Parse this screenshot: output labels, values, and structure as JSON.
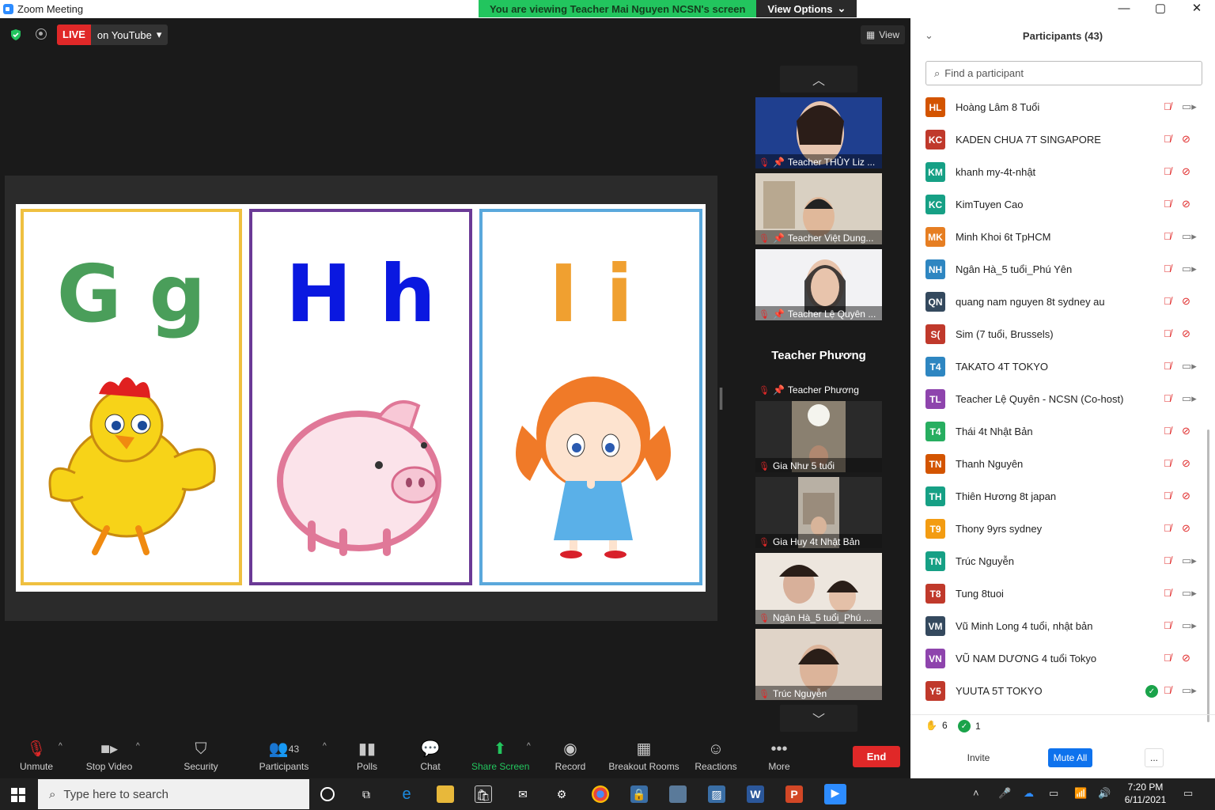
{
  "window": {
    "title": "Zoom Meeting",
    "controls": [
      "—",
      "▢",
      "✕"
    ]
  },
  "banner": {
    "viewing": "You are viewing Teacher Mai Nguyen NCSN's screen",
    "view_options": "View Options"
  },
  "top": {
    "live": "LIVE",
    "live_target": "on YouTube",
    "view": "View"
  },
  "slide": {
    "cards": [
      {
        "letter": "G g",
        "color": "#4a9e5a",
        "border": "#efc040",
        "picture": "chicken"
      },
      {
        "letter": "H h",
        "color": "#0a18e0",
        "border": "#6b3a96",
        "picture": "pig"
      },
      {
        "letter": "I i",
        "color": "#f0a030",
        "border": "#5aa8dc",
        "picture": "girl"
      }
    ]
  },
  "video_tiles": [
    {
      "name": "Teacher THỦY Liz ...",
      "pinned": true
    },
    {
      "name": "Teacher Việt Dung...",
      "pinned": true
    },
    {
      "name": "Teacher Lệ Quyên ...",
      "pinned": true
    },
    {
      "name": "Teacher Phương",
      "pinned": true,
      "big_name": "Teacher Phương"
    },
    {
      "name": "Gia Như  5 tuổi",
      "pinned": false
    },
    {
      "name": "Gia Huy 4t Nhật Bản",
      "pinned": false
    },
    {
      "name": "Ngân Hà_5 tuổi_Phú ...",
      "pinned": false
    },
    {
      "name": "Trúc Nguyễn",
      "pinned": false
    }
  ],
  "toolbar": {
    "unmute": "Unmute",
    "stop_video": "Stop Video",
    "security": "Security",
    "participants": "Participants",
    "participants_count": "43",
    "polls": "Polls",
    "chat": "Chat",
    "share_screen": "Share Screen",
    "record": "Record",
    "breakout": "Breakout Rooms",
    "reactions": "Reactions",
    "more": "More",
    "end": "End"
  },
  "panel": {
    "title": "Participants (43)",
    "search_placeholder": "Find a participant",
    "participants": [
      {
        "initials": "HL",
        "name": "Hoàng Lâm 8 Tuổi",
        "color": "#d35400",
        "video": "on"
      },
      {
        "initials": "KC",
        "name": "KADEN CHUA 7T SINGAPORE",
        "color": "#c0392b",
        "video": "off"
      },
      {
        "initials": "KM",
        "name": "khanh my-4t-nhật",
        "color": "#16a085",
        "video": "off"
      },
      {
        "initials": "KC",
        "name": "KimTuyen Cao",
        "color": "#16a085",
        "video": "off"
      },
      {
        "initials": "MK",
        "name": "Minh Khoi 6t TpHCM",
        "color": "#e67e22",
        "video": "on"
      },
      {
        "initials": "NH",
        "name": "Ngân Hà_5 tuổi_Phú Yên",
        "color": "#2e86c1",
        "video": "on"
      },
      {
        "initials": "QN",
        "name": "quang nam nguyen 8t sydney au",
        "color": "#34495e",
        "video": "off"
      },
      {
        "initials": "S(",
        "name": "Sim (7 tuổi, Brussels)",
        "color": "#c0392b",
        "video": "off"
      },
      {
        "initials": "T4",
        "name": "TAKATO 4T TOKYO",
        "color": "#2e86c1",
        "video": "on"
      },
      {
        "initials": "TL",
        "name": "Teacher Lệ Quyên - NCSN (Co-host)",
        "color": "#8e44ad",
        "video": "on"
      },
      {
        "initials": "T4",
        "name": "Thái 4t Nhật Bản",
        "color": "#27ae60",
        "video": "off"
      },
      {
        "initials": "TN",
        "name": "Thanh Nguyên",
        "color": "#d35400",
        "video": "off"
      },
      {
        "initials": "TH",
        "name": "Thiên Hương 8t japan",
        "color": "#16a085",
        "video": "off"
      },
      {
        "initials": "T9",
        "name": "Thony 9yrs sydney",
        "color": "#f39c12",
        "video": "off"
      },
      {
        "initials": "TN",
        "name": "Trúc Nguyễn",
        "color": "#16a085",
        "video": "on"
      },
      {
        "initials": "T8",
        "name": "Tung 8tuoi",
        "color": "#c0392b",
        "video": "on"
      },
      {
        "initials": "VM",
        "name": "Vũ Minh Long 4 tuổi, nhật bản",
        "color": "#34495e",
        "video": "on"
      },
      {
        "initials": "VN",
        "name": "VŨ NAM DƯƠNG 4 tuổi Tokyo",
        "color": "#8e44ad",
        "video": "off"
      },
      {
        "initials": "Y5",
        "name": "YUUTA 5T TOKYO",
        "color": "#c0392b",
        "video": "on",
        "check": true
      }
    ],
    "hands": "6",
    "yes": "1",
    "invite": "Invite",
    "mute_all": "Mute All",
    "more": "..."
  },
  "taskbar": {
    "search": "Type here to search",
    "time": "7:20 PM",
    "date": "6/11/2021"
  }
}
